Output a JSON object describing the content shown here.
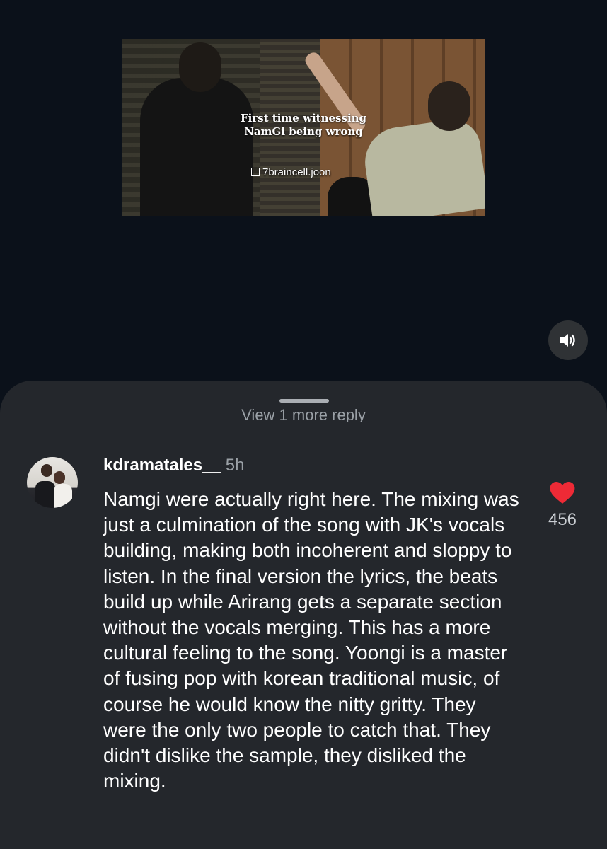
{
  "video": {
    "caption_line1": "First time witnessing",
    "caption_line2": "NamGi being wrong",
    "watermark": "7braincell.joon",
    "sound_icon": "speaker-volume-icon"
  },
  "comments_sheet": {
    "view_more_replies": "View 1 more reply",
    "comment": {
      "username": "kdramatales__",
      "time": "5h",
      "text": "Namgi were actually right here. The mixing was just a culmination of the song with JK's vocals building, making both incoherent and sloppy to listen.  In the final version the lyrics, the beats build up while Arirang gets a separate section without the vocals merging. This has a more cultural feeling to the song. Yoongi is a master of fusing pop with korean traditional music, of course he would know the nitty gritty. They were the only two people to catch that. They didn't dislike the sample, they disliked the mixing.",
      "like_count": "456",
      "like_icon": "heart-icon",
      "liked": true
    }
  },
  "colors": {
    "background": "#0b111a",
    "sheet": "#24272c",
    "like": "#ee2a36",
    "secondary_text": "#9aa0a6"
  }
}
